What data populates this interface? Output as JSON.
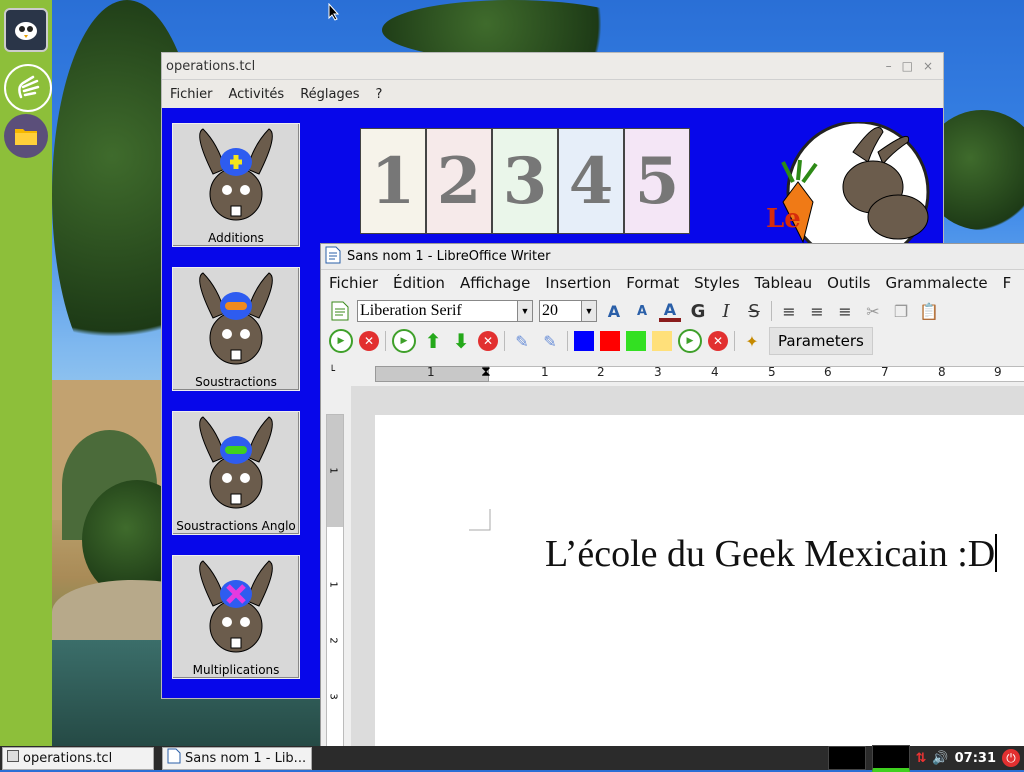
{
  "desktop": {
    "dock": {
      "items": [
        {
          "icon": "pidgin-owl-icon"
        },
        {
          "icon": "hand-icon"
        },
        {
          "icon": "folder-icon"
        }
      ]
    }
  },
  "operations_window": {
    "title": "operations.tcl",
    "controls": [
      "–",
      "□",
      "×"
    ],
    "menu": [
      "Fichier",
      "Activités",
      "Réglages",
      "?"
    ],
    "activities": [
      {
        "label": "Additions",
        "symbol": "+",
        "symbol_color": "#f5e51a"
      },
      {
        "label": "Soustractions",
        "symbol": "▬",
        "symbol_color": "#f08a1e"
      },
      {
        "label": "Soustractions Anglo",
        "symbol": "▬",
        "symbol_color": "#3fd11f"
      },
      {
        "label": "Multiplications",
        "symbol": "✕",
        "symbol_color": "#e63ae0"
      }
    ],
    "number_tiles": [
      "1",
      "2",
      "3",
      "4",
      "5"
    ],
    "logo_text": "Le"
  },
  "writer_window": {
    "title": "Sans nom 1 - LibreOffice Writer",
    "menu": [
      "Fichier",
      "Édition",
      "Affichage",
      "Insertion",
      "Format",
      "Styles",
      "Tableau",
      "Outils",
      "Grammalecte",
      "F"
    ],
    "font_name": "Liberation Serif",
    "font_size": "20",
    "format_buttons": {
      "bold": "G",
      "italic": "I",
      "strike": "S"
    },
    "extension_toolbar": {
      "parameters_label": "Parameters",
      "color_swatches": [
        "#0000ff",
        "#ff0000",
        "#33e022",
        "#ffe07a"
      ]
    },
    "ruler_labels": [
      "1",
      "1",
      "2",
      "3",
      "4",
      "5",
      "6",
      "7",
      "8",
      "9"
    ],
    "vertical_ruler_labels": [
      "1",
      "1",
      "2",
      "3"
    ],
    "document_text": "L’école du Geek Mexicain :D"
  },
  "taskbar": {
    "tasks": [
      "operations.tcl",
      "Sans nom 1 - Lib..."
    ],
    "clock": "07:31"
  }
}
